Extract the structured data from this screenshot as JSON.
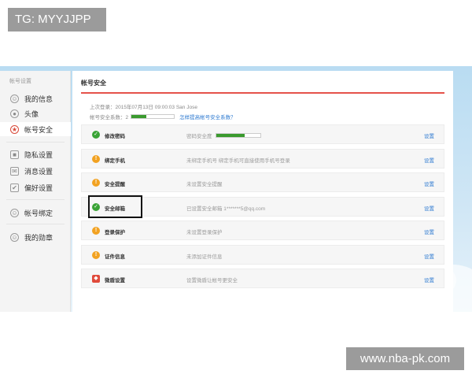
{
  "watermarks": {
    "top": "TG: MYYJJPP",
    "bottom": "www.nba-pk.com"
  },
  "sidebar": {
    "section_title": "帐号设置",
    "items": [
      {
        "label": "我的信息",
        "icon": "user-icon",
        "active": false
      },
      {
        "label": "头像",
        "icon": "avatar-icon",
        "active": false
      },
      {
        "label": "帐号安全",
        "icon": "shield-icon",
        "active": true
      },
      {
        "label": "隐私设置",
        "icon": "lock-icon",
        "active": false
      },
      {
        "label": "消息设置",
        "icon": "message-icon",
        "active": false
      },
      {
        "label": "偏好设置",
        "icon": "preference-icon",
        "active": false
      },
      {
        "label": "帐号绑定",
        "icon": "bind-icon",
        "active": false
      },
      {
        "label": "我的勋章",
        "icon": "medal-icon",
        "active": false
      }
    ]
  },
  "main": {
    "title": "帐号安全",
    "login_info": "上次登录：2015年07月13日  09:00:03  San Jose",
    "score_label": "帐号安全系数：2",
    "score_fraction": 0.35,
    "score_link": "怎样提高帐号安全系数？",
    "rows": [
      {
        "name": "修改密码",
        "status": "ok",
        "desc": "密码安全度",
        "bar": 0.65,
        "action": "设置"
      },
      {
        "name": "绑定手机",
        "status": "warn",
        "desc": "未绑定手机号  绑定手机可直接使用手机号登录",
        "action": "设置"
      },
      {
        "name": "安全提醒",
        "status": "warn",
        "desc": "未设置安全提醒",
        "action": "设置"
      },
      {
        "name": "安全邮箱",
        "status": "ok",
        "desc": "已设置安全邮箱 1*******5@qq.com",
        "action": "设置",
        "highlighted": true
      },
      {
        "name": "登录保护",
        "status": "warn",
        "desc": "未设置登录保护",
        "action": "设置"
      },
      {
        "name": "证件信息",
        "status": "warn",
        "desc": "未添加证件信息",
        "action": "设置"
      },
      {
        "name": "微盾设置",
        "status": "danger",
        "desc": "设置微盾让帐号更安全",
        "action": "设置"
      }
    ]
  },
  "colors": {
    "accent_red": "#e5524a",
    "ok_green": "#3aa336",
    "warn_orange": "#f2a221",
    "link_blue": "#2f7bd1"
  }
}
